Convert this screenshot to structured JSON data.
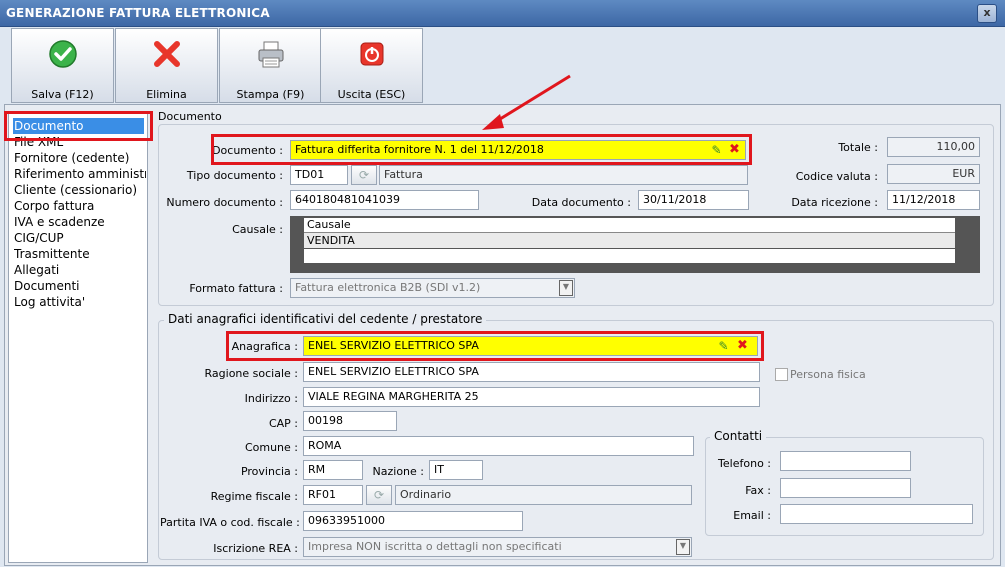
{
  "window": {
    "title": "GENERAZIONE FATTURA ELETTRONICA",
    "close_label": "x"
  },
  "toolbar": [
    {
      "label": "Salva (F12)",
      "icon": "check-icon"
    },
    {
      "label": "Elimina",
      "icon": "delete-icon"
    },
    {
      "label": "Stampa (F9)",
      "icon": "printer-icon"
    },
    {
      "label": "Uscita (ESC)",
      "icon": "exit-icon"
    }
  ],
  "sidebar": {
    "items": [
      "Documento",
      "File XML",
      "Fornitore (cedente)",
      "Riferimento amministrativo",
      "Cliente (cessionario)",
      "Corpo fattura",
      "IVA e scadenze",
      "CIG/CUP",
      "Trasmittente",
      "Allegati",
      "Documenti",
      "Log attivita'"
    ]
  },
  "doc": {
    "section_title": "Documento",
    "documento_label": "Documento :",
    "documento_value": "Fattura differita fornitore N. 1 del 11/12/2018",
    "tipo_label": "Tipo documento :",
    "tipo_code": "TD01",
    "tipo_desc": "Fattura",
    "numero_label": "Numero documento :",
    "numero_value": "640180481041039",
    "data_doc_label": "Data documento :",
    "data_doc_value": "30/11/2018",
    "totale_label": "Totale :",
    "totale_value": "110,00",
    "valuta_label": "Codice valuta :",
    "valuta_value": "EUR",
    "ricezione_label": "Data ricezione :",
    "ricezione_value": "11/12/2018",
    "causale_label": "Causale :",
    "causale_header": "Causale",
    "causale_rows": [
      "VENDITA"
    ],
    "formato_label": "Formato fattura :",
    "formato_value": "Fattura elettronica B2B (SDI v1.2)"
  },
  "cedente": {
    "section_title": "Dati anagrafici identificativi del cedente / prestatore",
    "anagrafica_label": "Anagrafica :",
    "anagrafica_value": "ENEL SERVIZIO ELETTRICO SPA",
    "ragione_label": "Ragione sociale :",
    "ragione_value": "ENEL SERVIZIO ELETTRICO SPA",
    "persona_label": "Persona fisica",
    "indirizzo_label": "Indirizzo :",
    "indirizzo_value": "VIALE REGINA MARGHERITA 25",
    "cap_label": "CAP :",
    "cap_value": "00198",
    "comune_label": "Comune :",
    "comune_value": "ROMA",
    "provincia_label": "Provincia :",
    "provincia_value": "RM",
    "nazione_label": "Nazione :",
    "nazione_value": "IT",
    "regime_label": "Regime fiscale :",
    "regime_code": "RF01",
    "regime_desc": "Ordinario",
    "piva_label": "Partita IVA o cod. fiscale :",
    "piva_value": "09633951000",
    "rea_label": "Iscrizione REA :",
    "rea_value": "Impresa NON iscritta o dettagli non specificati"
  },
  "contatti": {
    "title": "Contatti",
    "telefono_label": "Telefono :",
    "fax_label": "Fax :",
    "email_label": "Email :"
  }
}
